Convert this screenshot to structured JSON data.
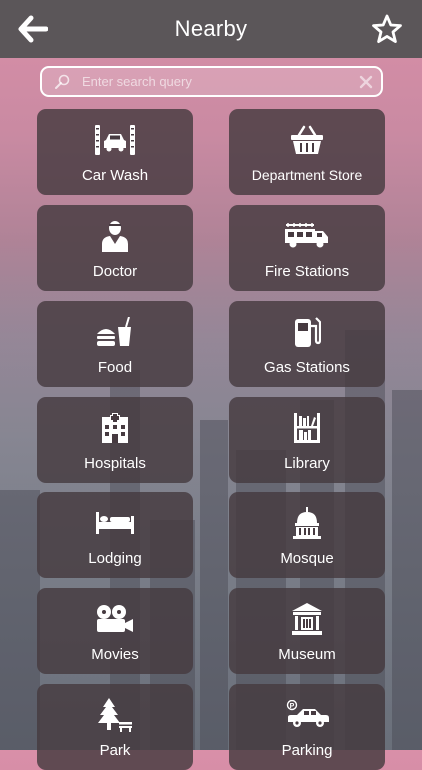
{
  "header": {
    "title": "Nearby",
    "back_icon": "arrow-left-icon",
    "favorite_icon": "star-outline-icon"
  },
  "search": {
    "placeholder": "Enter search query",
    "value": ""
  },
  "categories": [
    {
      "label": "Car Wash",
      "icon": "car-wash-icon"
    },
    {
      "label": "Department Store",
      "icon": "shopping-basket-icon"
    },
    {
      "label": "Doctor",
      "icon": "doctor-icon"
    },
    {
      "label": "Fire Stations",
      "icon": "fire-truck-icon"
    },
    {
      "label": "Food",
      "icon": "burger-drink-icon"
    },
    {
      "label": "Gas Stations",
      "icon": "gas-pump-icon"
    },
    {
      "label": "Hospitals",
      "icon": "hospital-building-icon"
    },
    {
      "label": "Library",
      "icon": "bookshelf-icon"
    },
    {
      "label": "Lodging",
      "icon": "bed-icon"
    },
    {
      "label": "Mosque",
      "icon": "dome-building-icon"
    },
    {
      "label": "Movies",
      "icon": "film-camera-icon"
    },
    {
      "label": "Museum",
      "icon": "museum-icon"
    },
    {
      "label": "Park",
      "icon": "tree-bench-icon"
    },
    {
      "label": "Parking",
      "icon": "parked-car-icon"
    }
  ],
  "colors": {
    "header_bg": "#5b5659",
    "tile_bg": "#463a40",
    "text": "#ffffff"
  }
}
